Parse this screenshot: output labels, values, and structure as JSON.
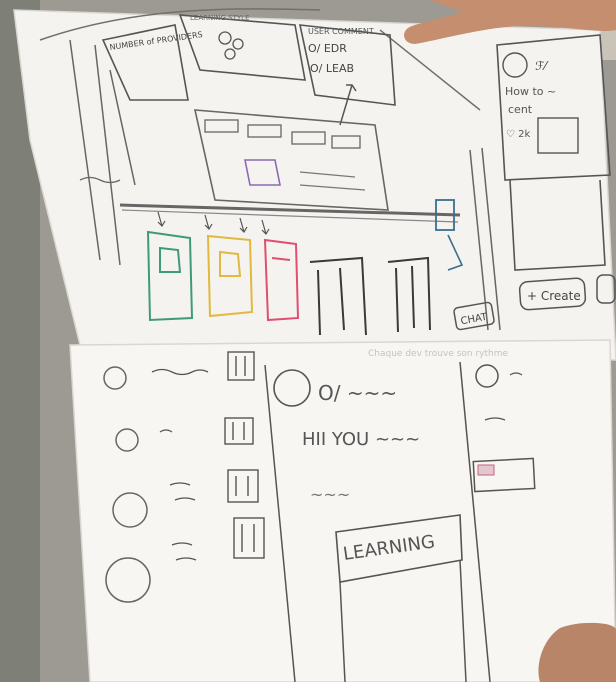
{
  "photo": {
    "subject": "hand-drawn paper wireframe held up to the camera",
    "top_sheet": {
      "banner_left": "NUMBER of PROVIDERS",
      "header_scribble": "LEARNING STYLE",
      "sticky_lines": [
        "USER COMMENT",
        "O/ EDR",
        "O/ LEAB"
      ],
      "thumbnail_texts": [
        "How to ~",
        "cent",
        "♡ 2k"
      ],
      "create_button": "+ Create",
      "chat_button": "CHAT",
      "pillar_colors": [
        "#3f9a7c",
        "#e0b93e",
        "#e04f6f",
        "#3a3a3a",
        "#3a3a3a"
      ]
    },
    "bottom_sheet": {
      "faint_header": "Chaque dev trouve son rythme",
      "greeting_lines": [
        "O/ ~~~",
        "HII YOU ~~~",
        "~~~"
      ],
      "learning_banner": "LEARNING"
    }
  }
}
